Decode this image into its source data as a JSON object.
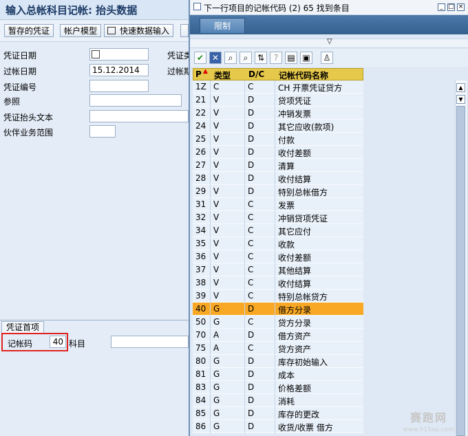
{
  "background": {
    "title": "输入总帐科目记帐: 抬头数据",
    "toolbar": [
      "暂存的凭证",
      "帐户模型",
      "快速数据输入"
    ],
    "fields": [
      {
        "label": "凭证日期",
        "value": ""
      },
      {
        "label": "过帐日期",
        "value": "15.12.2014"
      },
      {
        "label": "凭证编号",
        "value": ""
      },
      {
        "label": "参照",
        "value": ""
      },
      {
        "label": "凭证抬头文本",
        "value": ""
      },
      {
        "label": "伙伴业务范围",
        "value": ""
      }
    ],
    "right_labels": [
      "凭证类",
      "过帐期"
    ],
    "section_tab": "凭证首项",
    "posting_key_label": "记帐码",
    "posting_key_value": "40",
    "account_label": "科目"
  },
  "popup": {
    "title": "下一行项目的记帐代码 (2)   65 找到条目",
    "tab": "限制",
    "columns": [
      "P",
      "类型",
      "D/C",
      "记帐代码名称"
    ],
    "rows": [
      {
        "p": "1Z",
        "t": "C",
        "dc": "C",
        "n": "CH 开票凭证贷方"
      },
      {
        "p": "21",
        "t": "V",
        "dc": "D",
        "n": "贷项凭证"
      },
      {
        "p": "22",
        "t": "V",
        "dc": "D",
        "n": "冲销发票"
      },
      {
        "p": "24",
        "t": "V",
        "dc": "D",
        "n": "其它应收(款项)"
      },
      {
        "p": "25",
        "t": "V",
        "dc": "D",
        "n": "付款"
      },
      {
        "p": "26",
        "t": "V",
        "dc": "D",
        "n": "收付差额"
      },
      {
        "p": "27",
        "t": "V",
        "dc": "D",
        "n": "清算"
      },
      {
        "p": "28",
        "t": "V",
        "dc": "D",
        "n": "收付结算"
      },
      {
        "p": "29",
        "t": "V",
        "dc": "D",
        "n": "特别总帐借方"
      },
      {
        "p": "31",
        "t": "V",
        "dc": "C",
        "n": "发票"
      },
      {
        "p": "32",
        "t": "V",
        "dc": "C",
        "n": "冲销贷项凭证"
      },
      {
        "p": "34",
        "t": "V",
        "dc": "C",
        "n": "其它应付"
      },
      {
        "p": "35",
        "t": "V",
        "dc": "C",
        "n": "收款"
      },
      {
        "p": "36",
        "t": "V",
        "dc": "C",
        "n": "收付差额"
      },
      {
        "p": "37",
        "t": "V",
        "dc": "C",
        "n": "其他结算"
      },
      {
        "p": "38",
        "t": "V",
        "dc": "C",
        "n": "收付结算"
      },
      {
        "p": "39",
        "t": "V",
        "dc": "C",
        "n": "特别总帐贷方"
      },
      {
        "p": "40",
        "t": "G",
        "dc": "D",
        "n": "借方分录"
      },
      {
        "p": "50",
        "t": "G",
        "dc": "C",
        "n": "贷方分录"
      },
      {
        "p": "70",
        "t": "A",
        "dc": "D",
        "n": "借方资产"
      },
      {
        "p": "75",
        "t": "A",
        "dc": "C",
        "n": "贷方资产"
      },
      {
        "p": "80",
        "t": "G",
        "dc": "D",
        "n": "库存初始输入"
      },
      {
        "p": "81",
        "t": "G",
        "dc": "D",
        "n": "成本"
      },
      {
        "p": "83",
        "t": "G",
        "dc": "D",
        "n": "价格差额"
      },
      {
        "p": "84",
        "t": "G",
        "dc": "D",
        "n": "消耗"
      },
      {
        "p": "85",
        "t": "G",
        "dc": "D",
        "n": "库存的更改"
      },
      {
        "p": "86",
        "t": "G",
        "dc": "D",
        "n": "收货/收票 借方"
      }
    ],
    "selected_p": "40"
  },
  "watermark": "赛跑网",
  "watermark_url": "www.915ap.com"
}
